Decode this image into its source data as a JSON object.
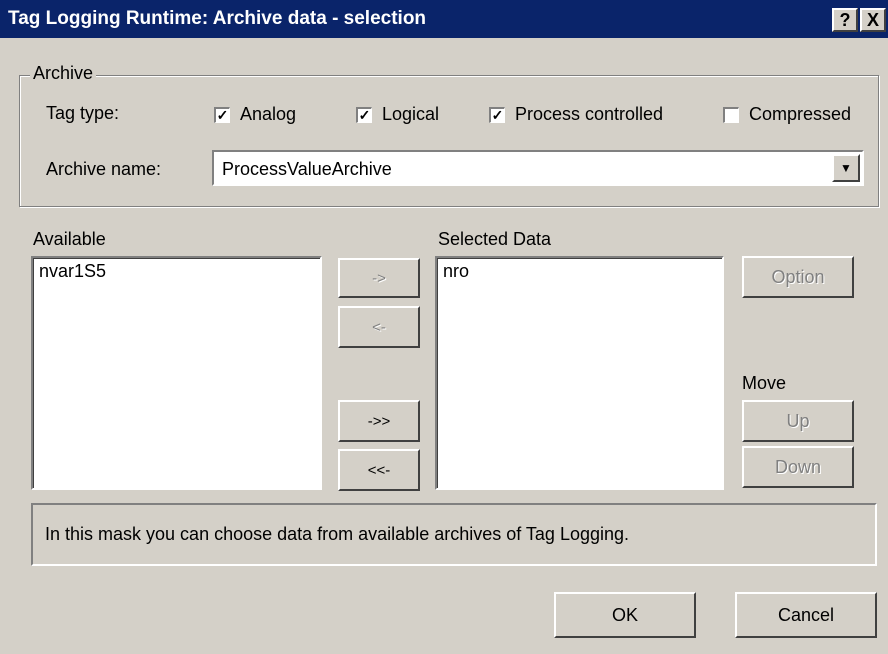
{
  "window": {
    "title": "Tag Logging Runtime: Archive data - selection",
    "help_label": "?",
    "close_label": "X"
  },
  "archive": {
    "group_label": "Archive",
    "tag_type_label": "Tag type:",
    "tag_types": [
      {
        "label": "Analog",
        "checked": true
      },
      {
        "label": "Logical",
        "checked": true
      },
      {
        "label": "Process controlled",
        "checked": true
      },
      {
        "label": "Compressed",
        "checked": false
      }
    ],
    "archive_name_label": "Archive name:",
    "archive_name_value": "ProcessValueArchive"
  },
  "available": {
    "label": "Available",
    "items": [
      "nvar1S5"
    ]
  },
  "selected": {
    "label": "Selected Data",
    "items": [
      "nro"
    ]
  },
  "transfer": {
    "add": "->",
    "remove": "<-",
    "add_all": "->>",
    "remove_all": "<<-"
  },
  "side": {
    "option": "Option",
    "move_label": "Move",
    "up": "Up",
    "down": "Down"
  },
  "info_text": "In this mask you can choose data from available archives of Tag Logging.",
  "footer": {
    "ok": "OK",
    "cancel": "Cancel"
  },
  "colors": {
    "titlebar": "#0a246a",
    "face": "#d4d0c8"
  }
}
